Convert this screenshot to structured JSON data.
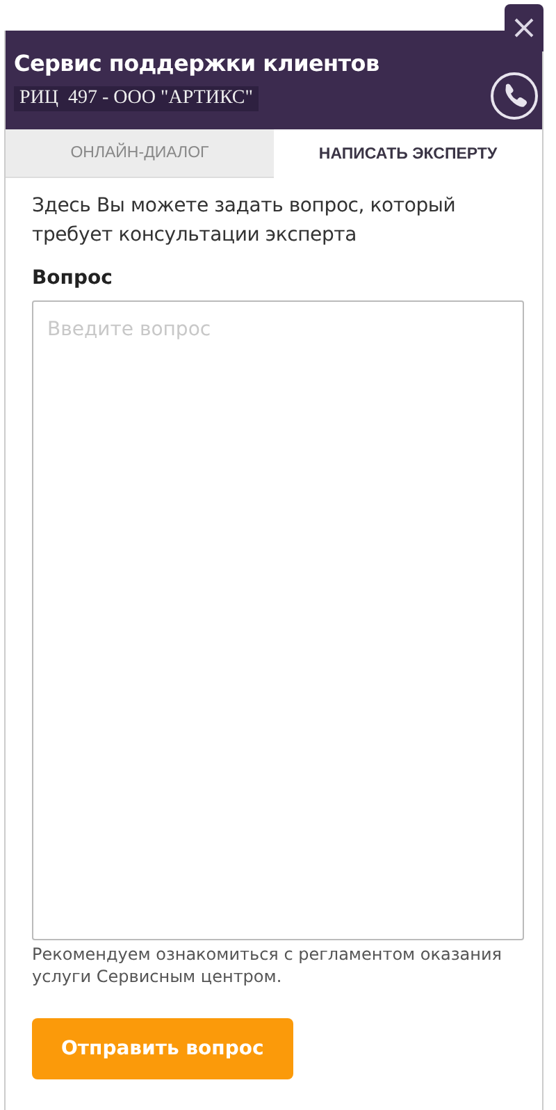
{
  "header": {
    "title": "Сервис поддержки клиентов",
    "subtitle": "РИЦ  497 - ООО \"АРТИКС\""
  },
  "tabs": [
    {
      "label": "ОНЛАЙН-ДИАЛОГ",
      "selected": false
    },
    {
      "label": "НАПИСАТЬ ЭКСПЕРТУ",
      "selected": true
    }
  ],
  "intro": "Здесь Вы можете задать вопрос, который требует консультации эксперта",
  "question": {
    "label": "Вопрос",
    "placeholder": "Введите вопрос"
  },
  "note": "Рекомендуем ознакомиться с регламентом оказания услуги Сервисным центром.",
  "submit": "Отправить вопрос"
}
